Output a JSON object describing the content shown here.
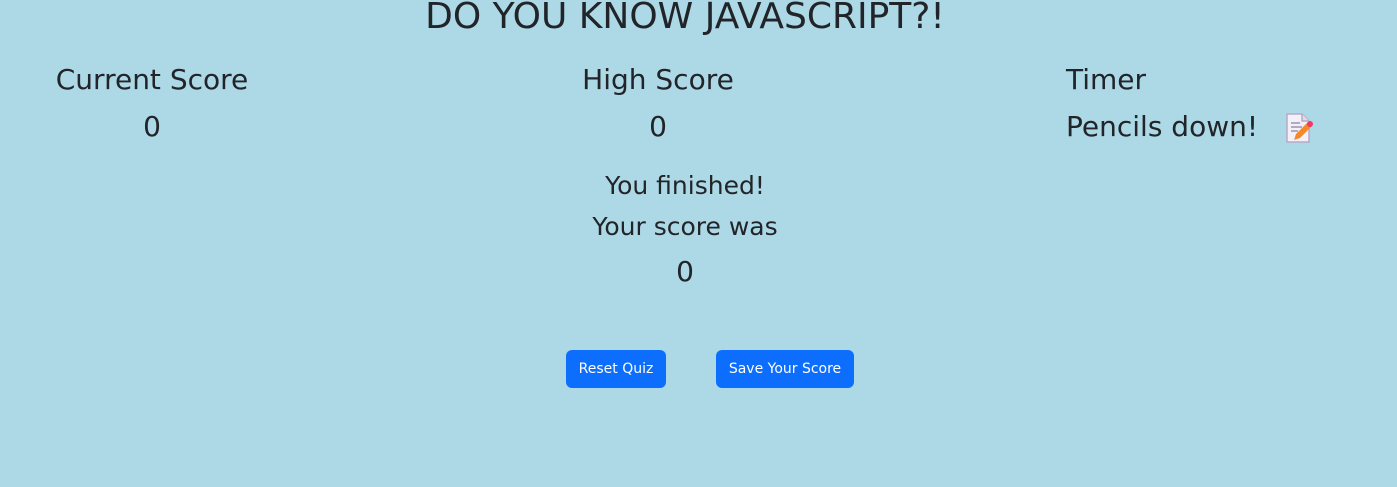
{
  "header": {
    "title": "DO YOU KNOW JAVASCRIPT?!"
  },
  "scores": {
    "current_label": "Current Score",
    "current_value": "0",
    "high_label": "High Score",
    "high_value": "0",
    "timer_label": "Timer",
    "timer_value": "Pencils down!",
    "timer_icon": "memo-emoji"
  },
  "result": {
    "finished": "You finished!",
    "score_was": "Your score was",
    "score": "0"
  },
  "buttons": {
    "reset": "Reset Quiz",
    "save": "Save Your Score"
  },
  "colors": {
    "background": "#add8e6",
    "button": "#0d6efd"
  }
}
